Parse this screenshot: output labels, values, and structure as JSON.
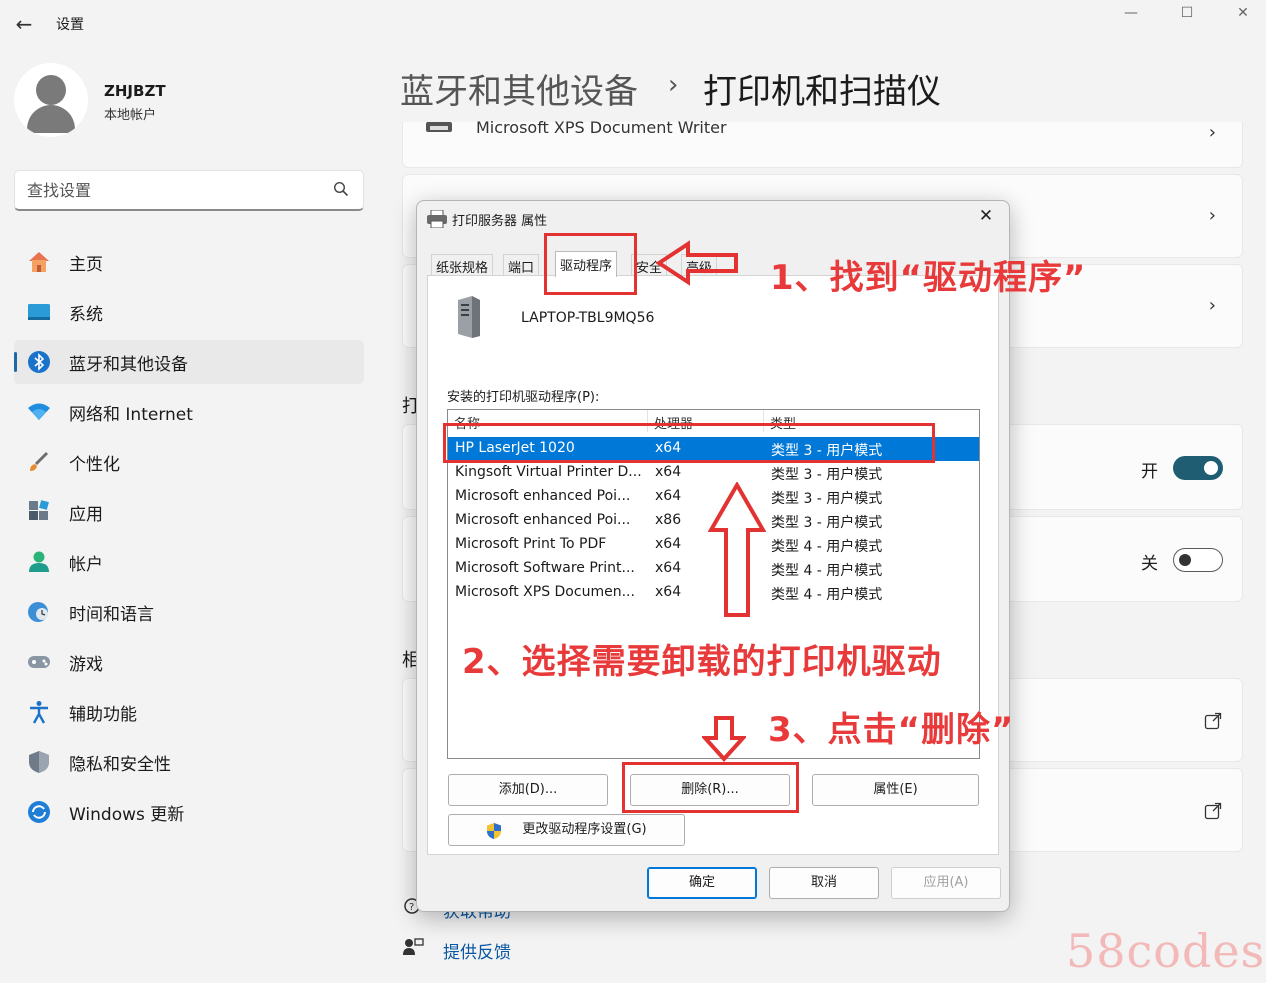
{
  "window": {
    "title": "设置",
    "back_icon": "arrow-left-icon",
    "controls": [
      "—",
      "☐",
      "✕"
    ]
  },
  "profile": {
    "name": "ZHJBZT",
    "account_type": "本地帐户"
  },
  "search": {
    "placeholder": "查找设置"
  },
  "sidebar": {
    "items": [
      {
        "label": "主页",
        "icon": "home-icon"
      },
      {
        "label": "系统",
        "icon": "system-icon"
      },
      {
        "label": "蓝牙和其他设备",
        "icon": "bluetooth-icon",
        "active": true
      },
      {
        "label": "网络和 Internet",
        "icon": "wifi-icon"
      },
      {
        "label": "个性化",
        "icon": "brush-icon"
      },
      {
        "label": "应用",
        "icon": "apps-icon"
      },
      {
        "label": "帐户",
        "icon": "account-icon"
      },
      {
        "label": "时间和语言",
        "icon": "clock-globe-icon"
      },
      {
        "label": "游戏",
        "icon": "gamepad-icon"
      },
      {
        "label": "辅助功能",
        "icon": "accessibility-icon"
      },
      {
        "label": "隐私和安全性",
        "icon": "shield-icon"
      },
      {
        "label": "Windows 更新",
        "icon": "sync-icon"
      }
    ]
  },
  "header": {
    "parent": "蓝牙和其他设备",
    "separator": "›",
    "title": "打印机和扫描仪"
  },
  "content": {
    "xps_writer": "Microsoft XPS Document Writer",
    "section_letters": [
      "打",
      "相"
    ],
    "toggles": [
      {
        "label": "开",
        "state": "on"
      },
      {
        "label": "关",
        "state": "off"
      }
    ],
    "links": [
      "获取帮助",
      "提供反馈"
    ]
  },
  "dialog": {
    "title": "打印服务器 属性",
    "close_label": "✕",
    "tabs": [
      "纸张规格",
      "端口",
      "驱动程序",
      "安全",
      "高级"
    ],
    "active_tab": "驱动程序",
    "server_name": "LAPTOP-TBL9MQ56",
    "drivers_label": "安装的打印机驱动程序(P):",
    "columns": [
      "名称",
      "处理器",
      "类型"
    ],
    "drivers": [
      {
        "name": "HP LaserJet 1020",
        "processor": "x64",
        "type": "类型 3 - 用户模式",
        "selected": true
      },
      {
        "name": "Kingsoft Virtual Printer D...",
        "processor": "x64",
        "type": "类型 3 - 用户模式"
      },
      {
        "name": "Microsoft enhanced Poi...",
        "processor": "x64",
        "type": "类型 3 - 用户模式"
      },
      {
        "name": "Microsoft enhanced Poi...",
        "processor": "x86",
        "type": "类型 3 - 用户模式"
      },
      {
        "name": "Microsoft Print To PDF",
        "processor": "x64",
        "type": "类型 4 - 用户模式"
      },
      {
        "name": "Microsoft Software Print...",
        "processor": "x64",
        "type": "类型 4 - 用户模式"
      },
      {
        "name": "Microsoft XPS Documen...",
        "processor": "x64",
        "type": "类型 4 - 用户模式"
      }
    ],
    "buttons": {
      "add": "添加(D)...",
      "remove": "删除(R)...",
      "properties": "属性(E)",
      "change_settings": "更改驱动程序设置(G)",
      "ok": "确定",
      "cancel": "取消",
      "apply": "应用(A)"
    }
  },
  "annotations": {
    "step1": "1、找到“驱动程序”",
    "step2": "2、选择需要卸载的打印机驱动",
    "step3": "3、点击“删除”",
    "color": "#e23232"
  },
  "watermark": "58codes",
  "colors": {
    "accent": "#1e6aa7",
    "selection": "#0078d7",
    "toggle_on": "#1f5d73"
  }
}
